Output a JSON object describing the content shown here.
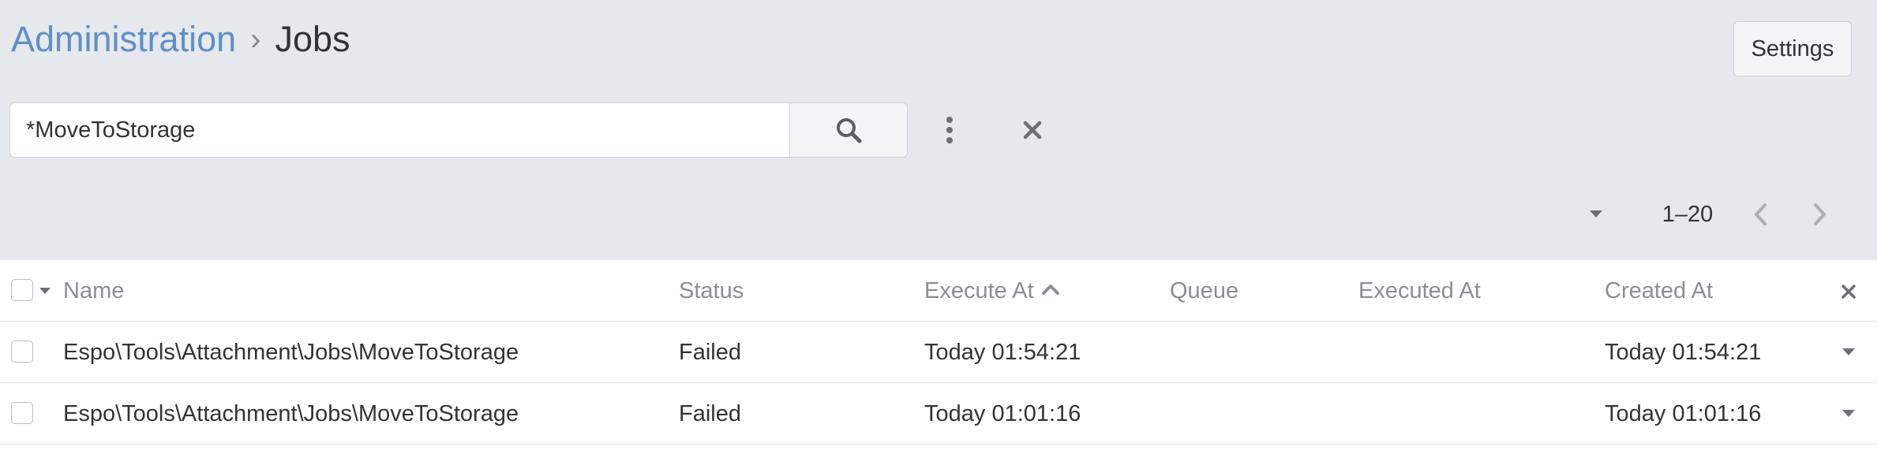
{
  "breadcrumb": {
    "parent": "Administration",
    "separator": "›",
    "current": "Jobs"
  },
  "toolbar": {
    "settings_label": "Settings"
  },
  "search": {
    "value": "*MoveToStorage",
    "placeholder": ""
  },
  "pagination": {
    "range": "1–20"
  },
  "table": {
    "columns": {
      "name": "Name",
      "status": "Status",
      "execute_at": "Execute At",
      "queue": "Queue",
      "executed_at": "Executed At",
      "created_at": "Created At"
    },
    "sort": {
      "column": "execute_at",
      "direction": "asc"
    },
    "rows": [
      {
        "name": "Espo\\Tools\\Attachment\\Jobs\\MoveToStorage",
        "status": "Failed",
        "execute_at": "Today 01:54:21",
        "queue": "",
        "executed_at": "",
        "created_at": "Today 01:54:21"
      },
      {
        "name": "Espo\\Tools\\Attachment\\Jobs\\MoveToStorage",
        "status": "Failed",
        "execute_at": "Today 01:01:16",
        "queue": "",
        "executed_at": "",
        "created_at": "Today 01:01:16"
      }
    ]
  },
  "colors": {
    "page_bg": "#e5e8ec",
    "link": "#5e8fc6",
    "failed": "#a94442",
    "muted": "#8a8f96"
  },
  "icons": [
    "search-icon",
    "kebab-menu-icon",
    "close-icon",
    "caret-down-icon",
    "chevron-left-icon",
    "chevron-right-icon",
    "sort-asc-icon"
  ]
}
